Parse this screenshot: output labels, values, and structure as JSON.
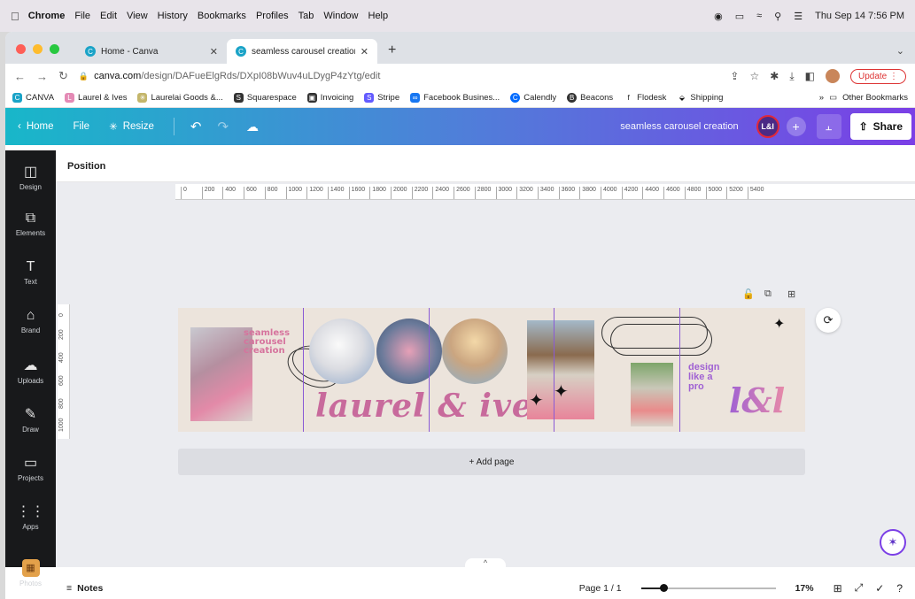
{
  "menubar": {
    "app": "Chrome",
    "items": [
      "File",
      "Edit",
      "View",
      "History",
      "Bookmarks",
      "Profiles",
      "Tab",
      "Window",
      "Help"
    ],
    "clock": "Thu Sep 14  7:56 PM"
  },
  "tabs": [
    {
      "title": "Home - Canva"
    },
    {
      "title": "seamless carousel creation - E"
    }
  ],
  "address": {
    "host": "canva.com",
    "path": "/design/DAFueElgRds/DXpI08bWuv4uLDygP4zYtg/edit",
    "update_label": "Update"
  },
  "bookmarks": {
    "items": [
      "CANVA",
      "Laurel & Ives",
      "Laurelai Goods &...",
      "Squarespace",
      "Invoicing",
      "Stripe",
      "Facebook Busines...",
      "Calendly",
      "Beacons",
      "Flodesk",
      "Shipping"
    ],
    "overflow": "»",
    "other": "Other Bookmarks"
  },
  "canva_header": {
    "home": "Home",
    "file": "File",
    "resize": "Resize",
    "design_title": "seamless carousel creation",
    "team_initials": "L&I",
    "share": "Share"
  },
  "rail": [
    "Design",
    "Elements",
    "Text",
    "Brand",
    "Uploads",
    "Draw",
    "Projects",
    "Apps",
    "Photos"
  ],
  "toolbar": {
    "position": "Position"
  },
  "ruler": {
    "h_ticks": [
      "0",
      "200",
      "400",
      "600",
      "800",
      "1000",
      "1200",
      "1400",
      "1600",
      "1800",
      "2000",
      "2200",
      "2400",
      "2600",
      "2800",
      "3000",
      "3200",
      "3400",
      "3600",
      "3800",
      "4000",
      "4200",
      "4400",
      "4600",
      "4800",
      "5000",
      "5200",
      "5400"
    ],
    "v_ticks": [
      "0",
      "200",
      "400",
      "600",
      "800",
      "1000"
    ]
  },
  "design": {
    "headline": [
      "seamless",
      "carousel",
      "creation"
    ],
    "script": "laurel & ives",
    "tagline": [
      "design",
      "like a",
      "pro"
    ],
    "monogram": "l&l"
  },
  "add_page": "+ Add page",
  "footer": {
    "notes": "Notes",
    "page": "Page 1 / 1",
    "zoom": "17%",
    "zoom_value": 0.17
  }
}
